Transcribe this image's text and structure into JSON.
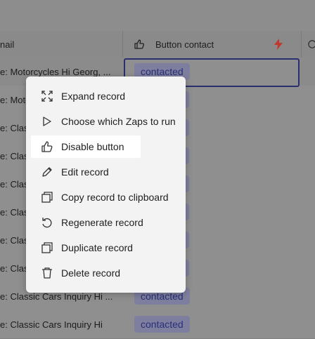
{
  "header": {
    "email_col": "nail",
    "button_col": "Button contact"
  },
  "rows": [
    {
      "email": "e: Motorcycles Hi Georg, ...",
      "status": "contacted"
    },
    {
      "email": "e: Moto",
      "status": ""
    },
    {
      "email": "e: Clas",
      "status": ""
    },
    {
      "email": "e: Clas",
      "status": ""
    },
    {
      "email": "e: Clas",
      "status": ""
    },
    {
      "email": "e: Clas",
      "status": ""
    },
    {
      "email": "e: Clas",
      "status": ""
    },
    {
      "email": "e: Clas",
      "status": ""
    },
    {
      "email": "e: Classic Cars Inquiry Hi ...",
      "status": "contacted"
    },
    {
      "email": "e: Classic Cars Inquiry Hi",
      "status": "contacted"
    }
  ],
  "menu": {
    "items": [
      {
        "label": "Expand record",
        "icon": "expand-icon"
      },
      {
        "label": "Choose which Zaps to run",
        "icon": "play-icon"
      },
      {
        "label": "Disable button",
        "icon": "thumbs-up-icon"
      },
      {
        "label": "Edit record",
        "icon": "pencil-icon"
      },
      {
        "label": "Copy record to clipboard",
        "icon": "copy-icon"
      },
      {
        "label": "Regenerate record",
        "icon": "regenerate-icon"
      },
      {
        "label": "Duplicate record",
        "icon": "duplicate-icon"
      },
      {
        "label": "Delete record",
        "icon": "trash-icon"
      }
    ]
  },
  "colors": {
    "badge_bg": "#7e7f9e",
    "badge_text": "#2a2f78",
    "bolt": "#c0392b",
    "overlay": "#8f8f8f"
  }
}
